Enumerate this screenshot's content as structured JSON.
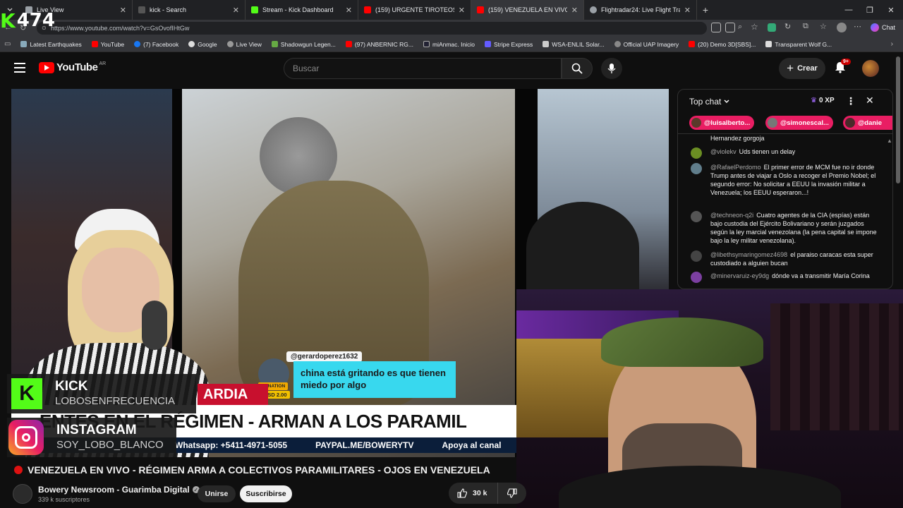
{
  "browser": {
    "tabs": [
      {
        "label": "Live View",
        "color": "#9aa0a6",
        "active": false
      },
      {
        "label": "kick - Search",
        "color": "#555",
        "active": false
      },
      {
        "label": "Stream - Kick Dashboard",
        "color": "#53fc18",
        "active": false
      },
      {
        "label": "(159) URGENTE TIROTEOS EN C",
        "color": "#ff0000",
        "active": false
      },
      {
        "label": "(159) VENEZUELA EN VIVO - R",
        "color": "#ff0000",
        "active": true
      },
      {
        "label": "Flightradar24: Live Flight Tracker -",
        "color": "#9aa0a6",
        "active": false
      }
    ],
    "url": "https://www.youtube.com/watch?v=GsOvofIHtGw",
    "chat_label": "Chat",
    "bookmarks": [
      {
        "label": "Latest Earthquakes",
        "color": "#8ab"
      },
      {
        "label": "YouTube",
        "color": "#ff0000"
      },
      {
        "label": "(7) Facebook",
        "color": "#1877f2"
      },
      {
        "label": "Google",
        "color": "#ddd"
      },
      {
        "label": "Live View",
        "color": "#999"
      },
      {
        "label": "Shadowgun Legen...",
        "color": "#6a4"
      },
      {
        "label": "(97) ANBERNIC RG...",
        "color": "#ff0000"
      },
      {
        "label": "miAnmac. Inicio",
        "color": "#223"
      },
      {
        "label": "Stripe Express",
        "color": "#635bff"
      },
      {
        "label": "WSA-ENLIL Solar...",
        "color": "#ccc"
      },
      {
        "label": "Official UAP Imagery",
        "color": "#888"
      },
      {
        "label": "(20) Demo 3D[SBS]...",
        "color": "#ff0000"
      },
      {
        "label": "Transparent Wolf G...",
        "color": "#ddd"
      }
    ]
  },
  "kick_badge": {
    "count": "474"
  },
  "youtube": {
    "logo_text": "YouTube",
    "region": "AR",
    "search_placeholder": "Buscar",
    "create_label": "Crear",
    "notif_count": "9+"
  },
  "video": {
    "donation": {
      "user": "@gerardoperez1632",
      "message": "china está gritando es que tienen miedo por algo",
      "tag": "DONATION",
      "amount": "USD 2.00"
    },
    "lower_third_left": "ARDIA",
    "headline": "ENTES EN EL RÉGIMEN - ARMAN A LOS PARAMIL",
    "ticker": [
      "Whatsapp: +5411-4971-5055",
      "PAYPAL.ME/BOWERYTV",
      "Apoya al canal"
    ],
    "socials": [
      {
        "name": "KICK",
        "handle": "LOBOSENFRECUENCIA"
      },
      {
        "name": "INSTAGRAM",
        "handle": "SOY_LOBO_BLANCO"
      }
    ]
  },
  "chat": {
    "mode": "Top chat",
    "xp": "0 XP",
    "pinned": [
      {
        "name": "@luisalberto...",
        "color": "#e91e63"
      },
      {
        "name": "@simonescal...",
        "color": "#e91e63"
      },
      {
        "name": "@danie",
        "color": "#e91e63"
      }
    ],
    "messages": [
      {
        "author": "",
        "text": "Hernandez gorgoja",
        "avatar": "#333"
      },
      {
        "author": "@violekv",
        "text": "Uds tienen un delay",
        "avatar": "#6b8e23"
      },
      {
        "author": "@RafaelPerdomo",
        "text": "El primer error de MCM fue no ir donde Trump antes de viajar a Oslo a recoger el Premio Nobel; el segundo error: No solicitar a EEUU la invasión militar a Venezuela; los EEUU esperaron...!",
        "avatar": "#607d8b"
      },
      {
        "author": "@techneon-q2i",
        "text": "Cuatro agentes de la CIA (espías) están bajo custodia del Ejército Bolivariano y serán juzgados según la ley marcial venezolana (la pena capital se impone bajo la ley militar venezolana).",
        "avatar": "#555"
      },
      {
        "author": "@libethsymaringomez4698",
        "text": "el paraiso caracas esta super custodiado a alguien bucan",
        "avatar": "#444"
      },
      {
        "author": "@minervaruiz-ey9dg",
        "text": "dónde va a transmitir María Corina",
        "avatar": "#7b3fa0"
      }
    ]
  },
  "watch": {
    "title": "VENEZUELA EN VIVO - RÉGIMEN ARMA A COLECTIVOS PARAMILITARES - OJOS EN VENEZUELA",
    "channel": "Bowery Newsroom - Guarimba Digital",
    "subs": "339 k suscriptores",
    "join_label": "Unirse",
    "subscribe_label": "Suscribirse",
    "likes": "30 k"
  }
}
